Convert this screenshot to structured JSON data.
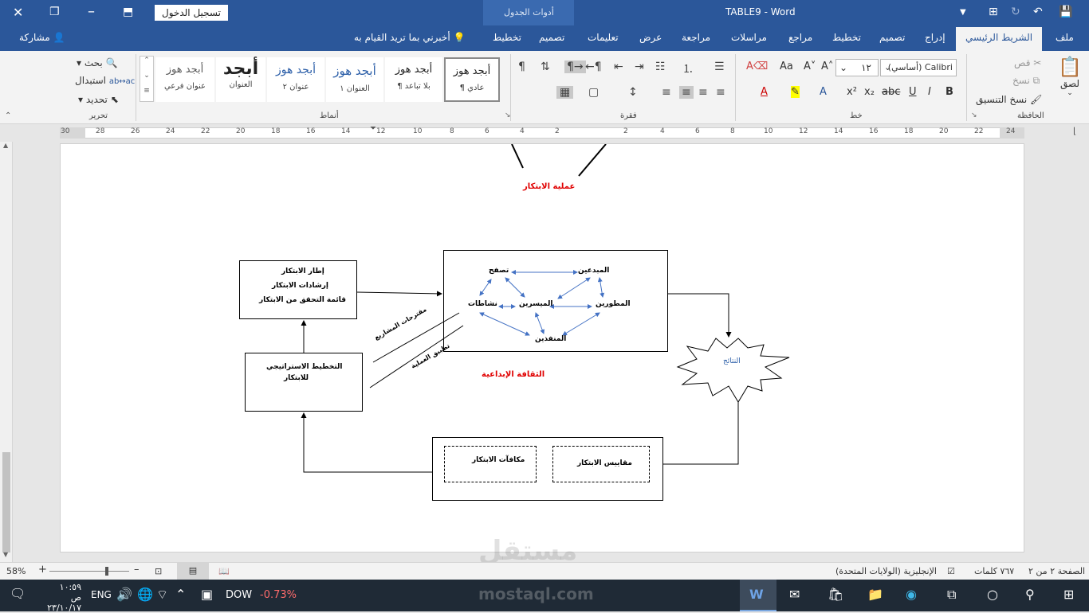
{
  "titlebar": {
    "doc_title": "TABLE9",
    "separator": "-",
    "app_name": "Word",
    "login_button": "تسجيل الدخول",
    "context_tab": "أدوات الجدول"
  },
  "tabs": [
    {
      "label": "ملف"
    },
    {
      "label": "الشريط الرئيسي"
    },
    {
      "label": "إدراج"
    },
    {
      "label": "تصميم"
    },
    {
      "label": "تخطيط"
    },
    {
      "label": "مراجع"
    },
    {
      "label": "مراسلات"
    },
    {
      "label": "مراجعة"
    },
    {
      "label": "عرض"
    },
    {
      "label": "تعليمات"
    },
    {
      "label": "تصميم"
    },
    {
      "label": "تخطيط"
    }
  ],
  "tell_me": "أخبرني بما تريد القيام به",
  "share": "مشاركة",
  "clipboard": {
    "paste": "لصق",
    "cut": "قص",
    "copy": "نسخ",
    "format_painter": "نسخ التنسيق",
    "label": "الحافظة"
  },
  "font": {
    "name": "Calibri (أساسي)",
    "size": "١٢",
    "label": "خط"
  },
  "paragraph": {
    "label": "فقرة"
  },
  "styles": {
    "label": "أنماط",
    "items": [
      {
        "sample": "أبجد هوز",
        "name": "¶ عادي"
      },
      {
        "sample": "أبجد هوز",
        "name": "¶ بلا تباعد"
      },
      {
        "sample": "أبجد هوز",
        "name": "العنوان ١"
      },
      {
        "sample": "أبجد هوز",
        "name": "عنوان ٢"
      },
      {
        "sample": "أبجد",
        "name": "العنوان"
      },
      {
        "sample": "أبجد هوز",
        "name": "عنوان فرعي"
      }
    ]
  },
  "editing": {
    "find": "بحث",
    "replace": "استبدال",
    "select": "تحديد",
    "label": "تحرير"
  },
  "ruler": {
    "numbers": [
      "30",
      "28",
      "26",
      "24",
      "22",
      "20",
      "18",
      "16",
      "14",
      "12",
      "10",
      "8",
      "6",
      "4",
      "2",
      "2",
      "4",
      "6",
      "8",
      "10",
      "12",
      "14",
      "16",
      "18",
      "20",
      "22",
      "24"
    ]
  },
  "diagram": {
    "top_label": "عملية الابتكار",
    "left_box": {
      "line1": "إطار الابتكار",
      "line2": "إرشادات الابتكار",
      "line3": "قائمة التحقق من الابتكار"
    },
    "strategy_box": {
      "line1": "التخطيط الاستراتيجي",
      "line2": "للابتكار"
    },
    "center_nodes": {
      "browse": "تصفح",
      "creatives": "المبدعين",
      "activities": "نشاطات",
      "facilitators": "الميسرين",
      "developers": "المطورين",
      "executors": "المنفذين"
    },
    "creative_culture": "الثقافة الإبداعية",
    "arrow_label_1": "مقترحات المشاريع",
    "arrow_label_2": "تطبيق العملية",
    "results": "النتائج",
    "measures": "مقاييس الابتكار",
    "rewards": "مكافآت الابتكار"
  },
  "status": {
    "page": "الصفحة ٢ من ٢",
    "words": "٧٦٧ كلمات",
    "language": "الإنجليزية (الولايات المتحدة)",
    "zoom": "58%"
  },
  "taskbar": {
    "time": "١٠:٥٩ ص",
    "date": "٢٣/١٠/١٧",
    "lang": "ENG",
    "stock_name": "DOW",
    "stock_change": "-0.73%",
    "stock_color": "#ff6b6b"
  },
  "watermark": {
    "brand": "مستقل",
    "url": "mostaql.com"
  }
}
